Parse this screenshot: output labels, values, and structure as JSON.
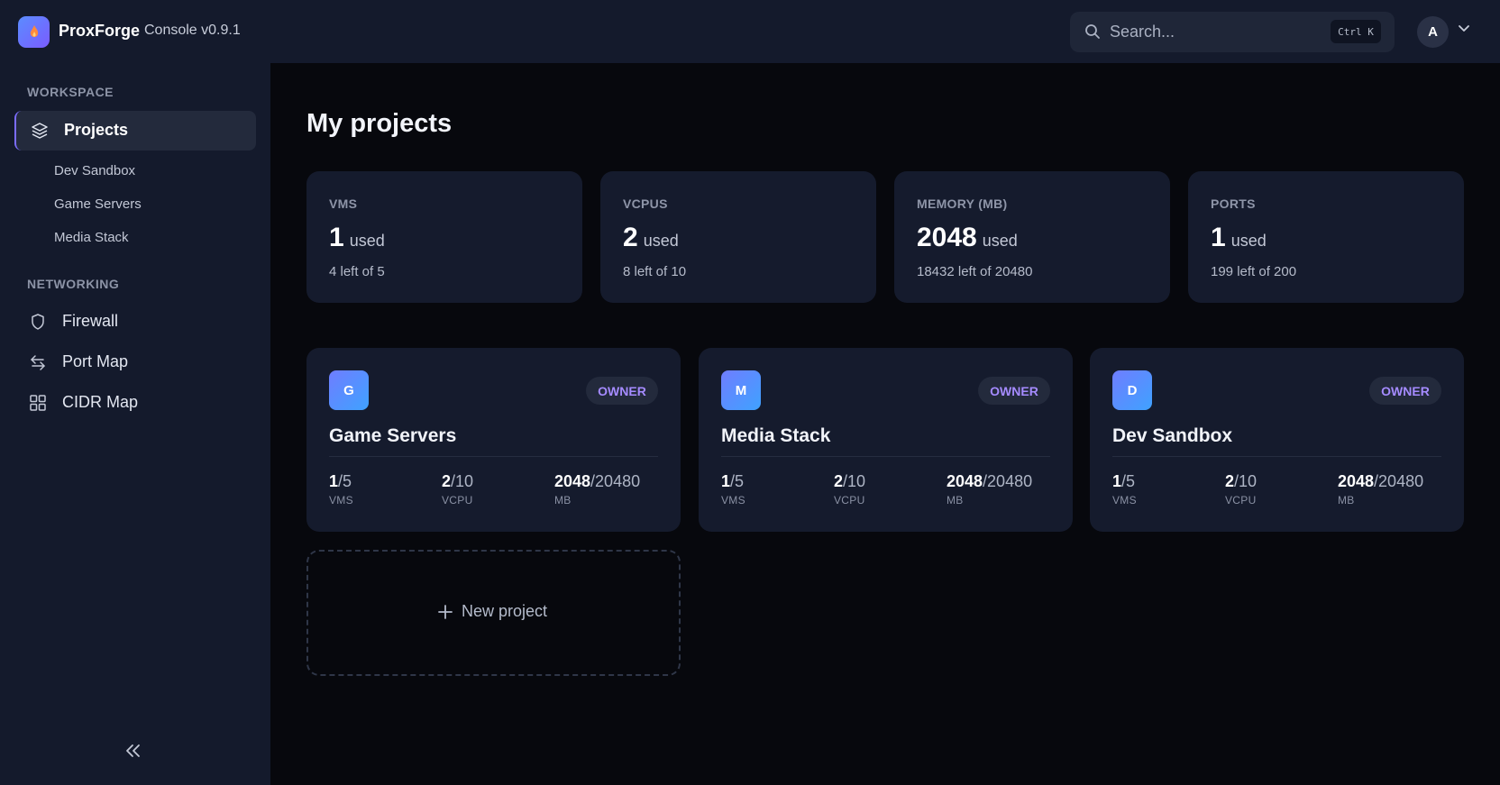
{
  "header": {
    "brand": "ProxForge",
    "version": "Console v0.9.1",
    "search_placeholder": "Search...",
    "search_shortcut": "Ctrl K",
    "avatar_initial": "A"
  },
  "sidebar": {
    "workspace_label": "WORKSPACE",
    "projects_label": "Projects",
    "project_links": [
      "Dev Sandbox",
      "Game Servers",
      "Media Stack"
    ],
    "networking_label": "NETWORKING",
    "networking_items": [
      {
        "label": "Firewall",
        "icon": "shield-icon"
      },
      {
        "label": "Port Map",
        "icon": "arrows-swap-icon"
      },
      {
        "label": "CIDR Map",
        "icon": "grid-icon"
      }
    ]
  },
  "main": {
    "title": "My projects",
    "stats": [
      {
        "label": "VMS",
        "value": "1",
        "used": "used",
        "sub": "4 left of 5"
      },
      {
        "label": "VCPUS",
        "value": "2",
        "used": "used",
        "sub": "8 left of 10"
      },
      {
        "label": "MEMORY (MB)",
        "value": "2048",
        "used": "used",
        "sub": "18432 left of 20480"
      },
      {
        "label": "PORTS",
        "value": "1",
        "used": "used",
        "sub": "199 left of 200"
      }
    ],
    "projects": [
      {
        "initial": "G",
        "name": "Game Servers",
        "role": "OWNER",
        "vms_used": "1",
        "vms_total": "/5",
        "vms_unit": "VMS",
        "vcpu_used": "2",
        "vcpu_total": "/10",
        "vcpu_unit": "VCPU",
        "mem_used": "2048",
        "mem_total": "/20480",
        "mem_unit": "MB"
      },
      {
        "initial": "M",
        "name": "Media Stack",
        "role": "OWNER",
        "vms_used": "1",
        "vms_total": "/5",
        "vms_unit": "VMS",
        "vcpu_used": "2",
        "vcpu_total": "/10",
        "vcpu_unit": "VCPU",
        "mem_used": "2048",
        "mem_total": "/20480",
        "mem_unit": "MB"
      },
      {
        "initial": "D",
        "name": "Dev Sandbox",
        "role": "OWNER",
        "vms_used": "1",
        "vms_total": "/5",
        "vms_unit": "VMS",
        "vcpu_used": "2",
        "vcpu_total": "/10",
        "vcpu_unit": "VCPU",
        "mem_used": "2048",
        "mem_total": "/20480",
        "mem_unit": "MB"
      }
    ],
    "new_project_label": "New project"
  },
  "colors": {
    "background": "#07080d",
    "panel": "#141a2c",
    "card": "#151b2d",
    "accent": "#7b6cff",
    "badge_text": "#a58bff"
  }
}
